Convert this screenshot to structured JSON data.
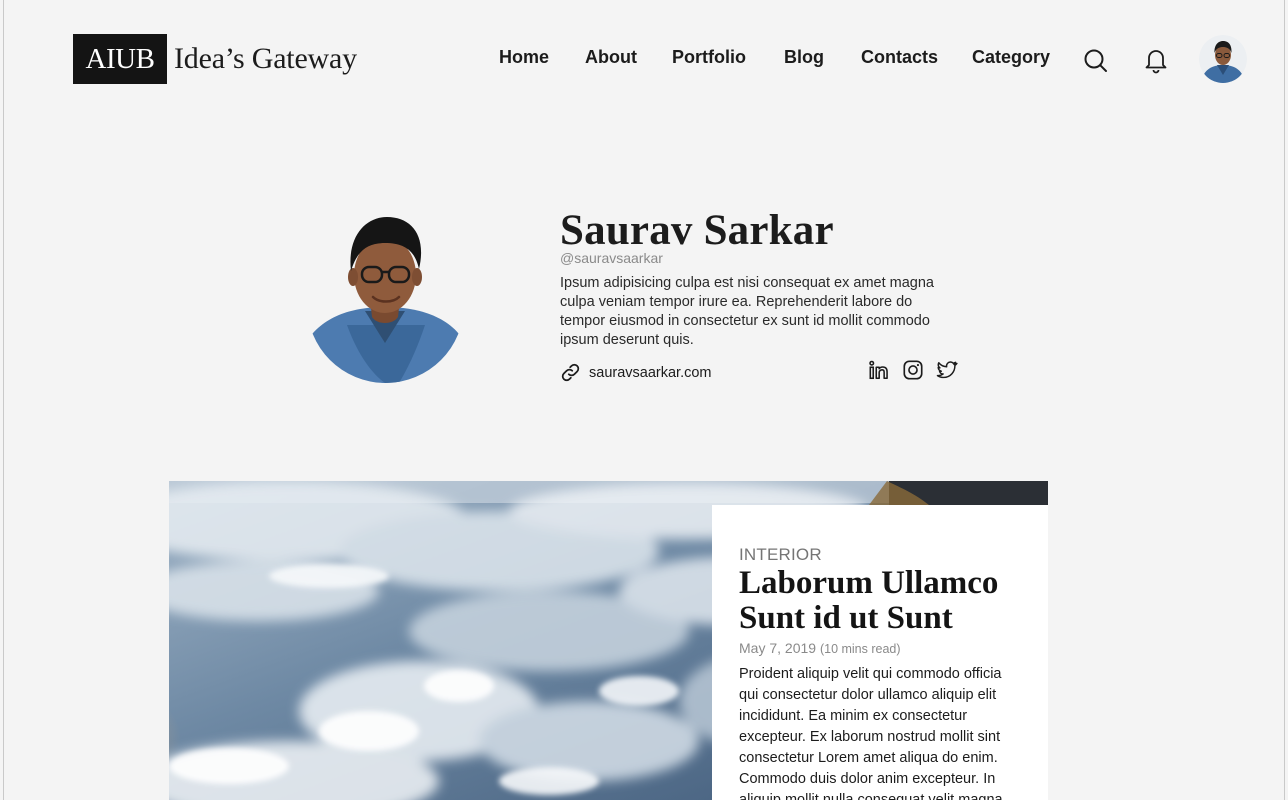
{
  "header": {
    "logo_mark": "AIUB",
    "logo_text": "Idea’s Gateway",
    "nav": [
      "Home",
      "About",
      "Portfolio",
      "Blog",
      "Contacts",
      "Category"
    ],
    "icons": {
      "search": "search-icon",
      "notifications": "bell-icon",
      "profile": "avatar"
    }
  },
  "profile": {
    "name": "Saurav Sarkar",
    "handle": "@sauravsaarkar",
    "bio": "Ipsum adipisicing culpa est nisi consequat ex amet magna culpa veniam tempor irure ea. Reprehenderit labore do tempor eiusmod in consectetur ex sunt id mollit commodo ipsum deserunt quis.",
    "website": "sauravsaarkar.com",
    "socials": [
      "linkedin-icon",
      "instagram-icon",
      "twitter-icon"
    ]
  },
  "featured": {
    "category": "INTERIOR",
    "title": "Laborum Ullamco Sunt id ut Sunt",
    "date": "May 7, 2019",
    "read_time": "(10 mins read)",
    "excerpt": "Proident aliquip velit qui commodo officia qui consectetur dolor ullamco aliquip elit incididunt. Ea minim ex consectetur excepteur. Ex laborum nostrud mollit sint consectetur Lorem amet aliqua do enim. Commodo duis dolor anim excepteur. In aliquip mollit nulla consequat velit magna."
  },
  "colors": {
    "background": "#f4f4f4",
    "text": "#1c1c1c",
    "logo_bg": "#141414",
    "card_bg": "#ffffff"
  }
}
